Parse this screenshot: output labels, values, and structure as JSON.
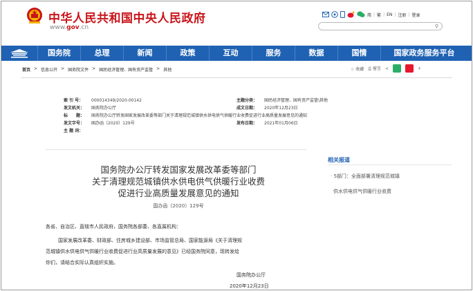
{
  "header": {
    "site_title": "中华人民共和国中央人民政府",
    "site_url_prefix": "www.",
    "site_url_brand": "gov",
    "site_url_suffix": ".cn",
    "top_links": [
      "简",
      "繁",
      "EN",
      "注册",
      "登录"
    ],
    "icons": [
      "mail-icon",
      "weibo-icon",
      "mobile-icon",
      "sina-weibo-icon",
      "wechat-icon"
    ]
  },
  "nav": {
    "items": [
      "国务院",
      "总理",
      "新闻",
      "政策",
      "互动",
      "服务",
      "数据",
      "国情"
    ],
    "wide_item": "国家政务服务平台"
  },
  "breadcrumb": [
    "首页",
    ">",
    "信息公开",
    ">",
    "国务院文件",
    ">",
    "国民经济管理、国有资产监管",
    ">",
    "其他"
  ],
  "share": {
    "favorite": "☆ 收藏",
    "print": "⎙ 留言",
    "share_symbol": "<"
  },
  "meta": {
    "index_no_label": "索 引 号：",
    "index_no": "000014349/2020-00142",
    "topic_label": "主题分类：",
    "topic": "国民经济管理、国有资产监管\\其他",
    "issuer_label": "发文机关：",
    "issuer": "国务院办公厅",
    "date_label": "成文日期：",
    "date": "2020年12月23日",
    "title_label": "标　　题：",
    "title": "国务院办公厅转发国家发展改革委等部门关于清理规范城镇供水供电供气供暖行业收费促进行业高质量发展意见的通知",
    "doc_no_label": "发文字号：",
    "doc_no": "国办函〔2020〕129号",
    "publish_label": "发布日期：",
    "publish": "2021年01月06日",
    "keywords_label": "主 题 词："
  },
  "document": {
    "title_lines": [
      "国务院办公厅转发国家发展改革委等部门",
      "关于清理规范城镇供水供电供气供暖行业收费",
      "促进行业高质量发展意见的通知"
    ],
    "doc_no": "国办函〔2020〕129号",
    "salutation": "各省、自治区、直辖市人民政府，国务院各部委、各直属机构：",
    "body_lines": [
      "国家发展改革委、财政部、住房城乡建设部、市场监管总局、国家能源局《关于清理规",
      "范城镇供水供电供气供暖行业收费促进行业高质量发展的意见》已经国务院同意，现转发给",
      "你们，请结合实际认真组织实施。"
    ],
    "signer": "国务院办公厅",
    "sign_date": "2020年12月23日"
  },
  "sidebar": {
    "heading": "相关报道",
    "items": [
      "5部门：全面部署清理规范城镇供水供电供气供暖行业收费"
    ],
    "item_lines": [
      "· 5部门：全面部署清理规范城镇",
      "供水供电供气供暖行业收费"
    ]
  },
  "colors": {
    "brand_red": "#c8141a",
    "nav_blue": "#1f62b3"
  }
}
